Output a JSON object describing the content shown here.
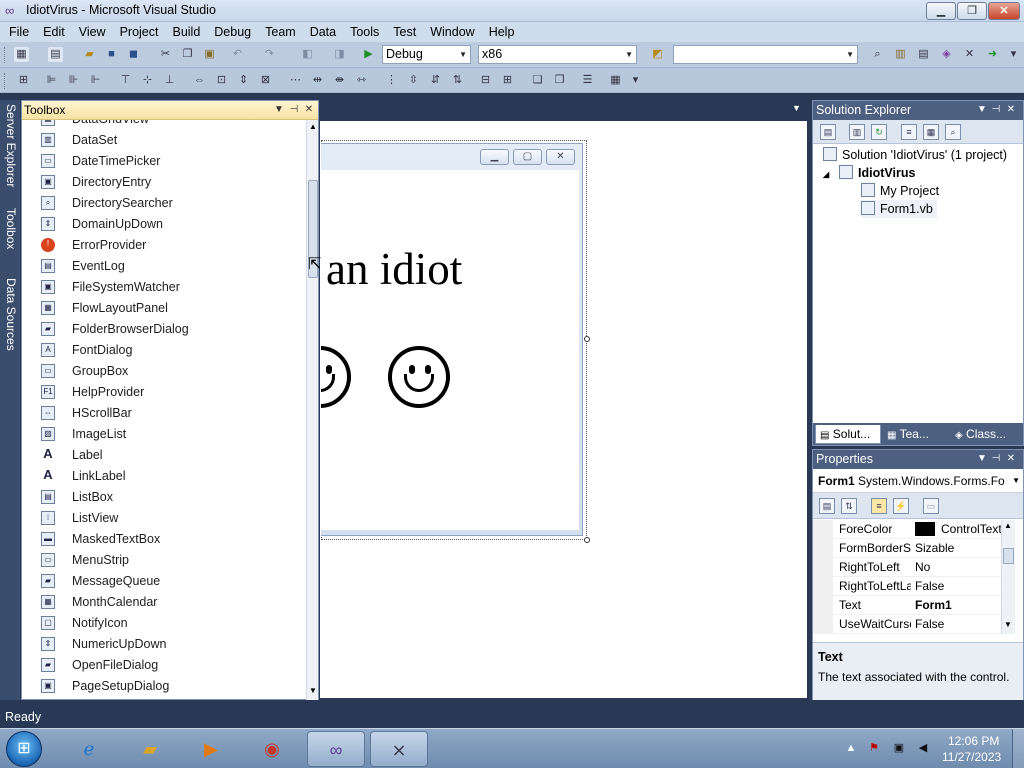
{
  "window": {
    "title": "IdiotVirus - Microsoft Visual Studio",
    "minimize": "▁",
    "maximize": "❐",
    "close": "✕"
  },
  "menu": [
    "File",
    "Edit",
    "View",
    "Project",
    "Build",
    "Debug",
    "Team",
    "Data",
    "Tools",
    "Test",
    "Window",
    "Help"
  ],
  "toolbar": {
    "configuration": "Debug",
    "platform": "x86",
    "find_value": ""
  },
  "side_tabs": [
    "Server Explorer",
    "Toolbox",
    "Data Sources"
  ],
  "toolbox": {
    "title": "Toolbox",
    "items": [
      {
        "label": "DataGridView",
        "icon": "datagridview-icon"
      },
      {
        "label": "DataSet",
        "icon": "dataset-icon"
      },
      {
        "label": "DateTimePicker",
        "icon": "datetimepicker-icon"
      },
      {
        "label": "DirectoryEntry",
        "icon": "directoryentry-icon"
      },
      {
        "label": "DirectorySearcher",
        "icon": "directorysearcher-icon"
      },
      {
        "label": "DomainUpDown",
        "icon": "domainupdown-icon"
      },
      {
        "label": "ErrorProvider",
        "icon": "errorprovider-icon"
      },
      {
        "label": "EventLog",
        "icon": "eventlog-icon"
      },
      {
        "label": "FileSystemWatcher",
        "icon": "filesystemwatcher-icon"
      },
      {
        "label": "FlowLayoutPanel",
        "icon": "flowlayoutpanel-icon"
      },
      {
        "label": "FolderBrowserDialog",
        "icon": "folderbrowserdialog-icon"
      },
      {
        "label": "FontDialog",
        "icon": "fontdialog-icon"
      },
      {
        "label": "GroupBox",
        "icon": "groupbox-icon"
      },
      {
        "label": "HelpProvider",
        "icon": "helpprovider-icon"
      },
      {
        "label": "HScrollBar",
        "icon": "hscrollbar-icon"
      },
      {
        "label": "ImageList",
        "icon": "imagelist-icon"
      },
      {
        "label": "Label",
        "icon": "label-icon"
      },
      {
        "label": "LinkLabel",
        "icon": "linklabel-icon"
      },
      {
        "label": "ListBox",
        "icon": "listbox-icon"
      },
      {
        "label": "ListView",
        "icon": "listview-icon"
      },
      {
        "label": "MaskedTextBox",
        "icon": "maskedtextbox-icon"
      },
      {
        "label": "MenuStrip",
        "icon": "menustrip-icon"
      },
      {
        "label": "MessageQueue",
        "icon": "messagequeue-icon"
      },
      {
        "label": "MonthCalendar",
        "icon": "monthcalendar-icon"
      },
      {
        "label": "NotifyIcon",
        "icon": "notifyicon-icon"
      },
      {
        "label": "NumericUpDown",
        "icon": "numericupdown-icon"
      },
      {
        "label": "OpenFileDialog",
        "icon": "openfiledialog-icon"
      },
      {
        "label": "PageSetupDialog",
        "icon": "pagesetupdialog-icon"
      }
    ]
  },
  "designer": {
    "form_text": "an idiot",
    "smiley_count": 2
  },
  "solution_explorer": {
    "title": "Solution Explorer",
    "tree": [
      {
        "label": "Solution 'IdiotVirus' (1 project)",
        "level": 0,
        "bold": false
      },
      {
        "label": "IdiotVirus",
        "level": 1,
        "bold": true
      },
      {
        "label": "My Project",
        "level": 2,
        "bold": false
      },
      {
        "label": "Form1.vb",
        "level": 2,
        "bold": false
      }
    ],
    "tabs": [
      "Solut...",
      "Tea...",
      "Class..."
    ]
  },
  "properties": {
    "title": "Properties",
    "object_name": "Form1",
    "object_type": "System.Windows.Forms.Fo",
    "rows": [
      {
        "name": "ForeColor",
        "value": "ControlText",
        "swatch": "#000000",
        "bold": false
      },
      {
        "name": "FormBorderStyle",
        "value": "Sizable",
        "bold": false
      },
      {
        "name": "RightToLeft",
        "value": "No",
        "bold": false
      },
      {
        "name": "RightToLeftLayout",
        "value": "False",
        "bold": false
      },
      {
        "name": "Text",
        "value": "Form1",
        "bold": true
      },
      {
        "name": "UseWaitCursor",
        "value": "False",
        "bold": false
      }
    ],
    "description_title": "Text",
    "description_text": "The text associated with the control."
  },
  "status": "Ready",
  "taskbar": {
    "time": "12:06 PM",
    "date": "11/27/2023"
  },
  "colors": {
    "chrome_dark": "#293955",
    "panel_header": "#4d6082",
    "toolbox_header": "#f6e3a2"
  }
}
